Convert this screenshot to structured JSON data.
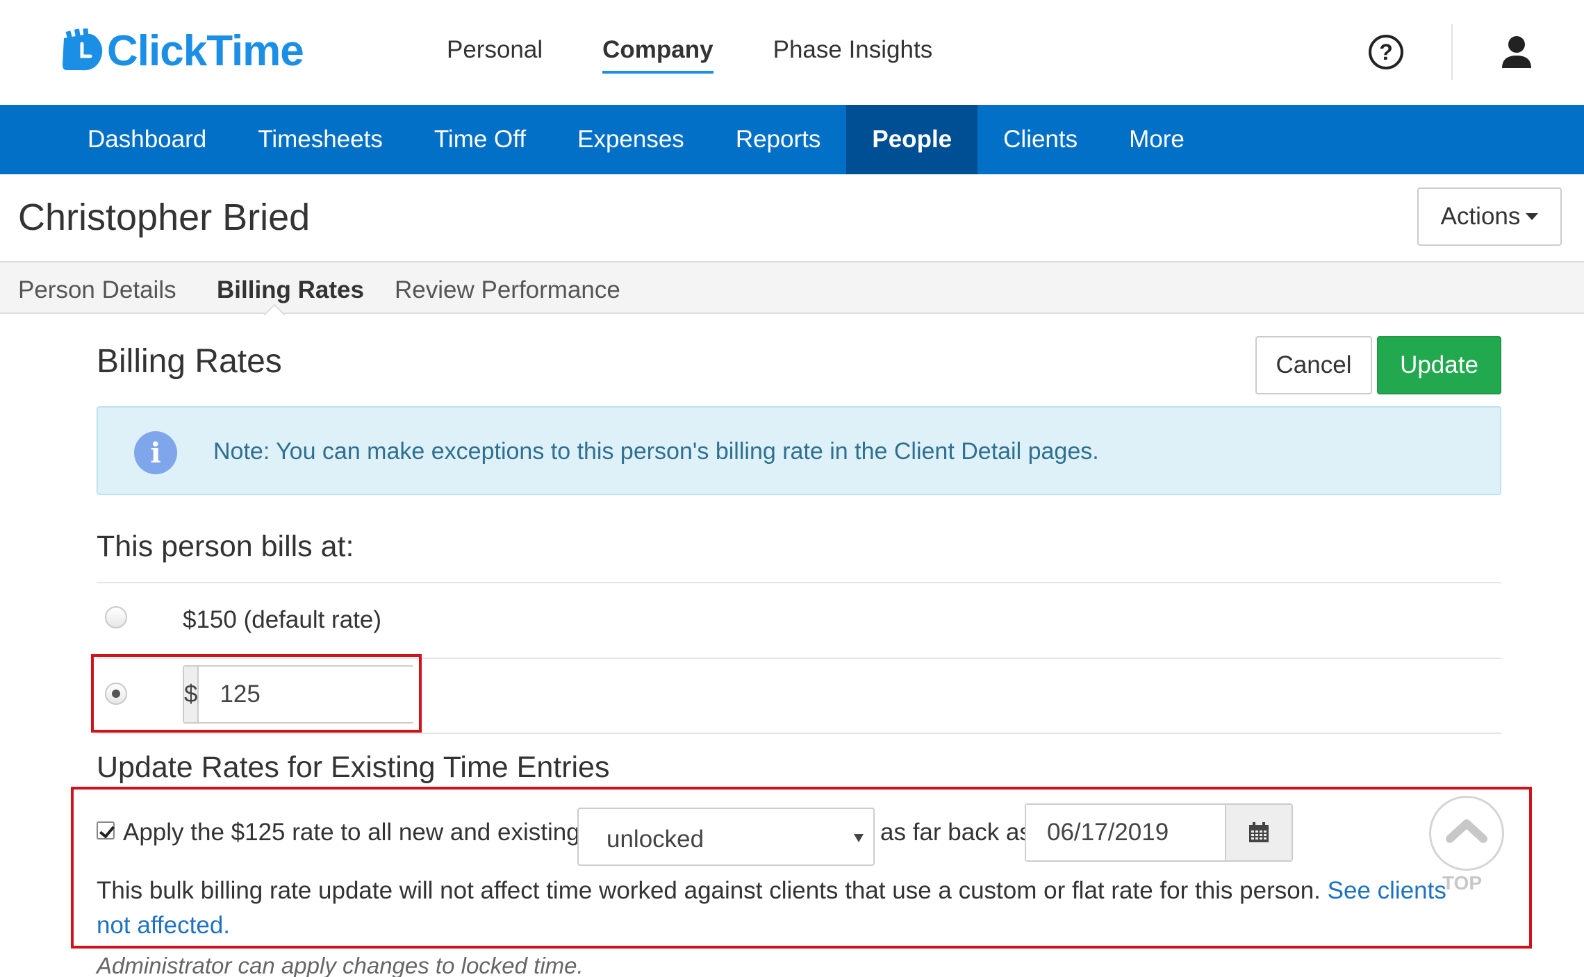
{
  "brand": {
    "name": "ClickTime",
    "color": "#1b8fe6"
  },
  "top_nav": {
    "items": [
      "Personal",
      "Company",
      "Phase Insights"
    ],
    "active": "Company"
  },
  "header_icons": [
    "help-icon",
    "user-icon"
  ],
  "main_nav": {
    "items": [
      "Dashboard",
      "Timesheets",
      "Time Off",
      "Expenses",
      "Reports",
      "People",
      "Clients",
      "More"
    ],
    "active": "People",
    "bg_color": "#0370c8"
  },
  "page": {
    "title": "Christopher Bried",
    "actions_label": "Actions"
  },
  "tabs": {
    "items": [
      "Person Details",
      "Billing Rates",
      "Review Performance"
    ],
    "active": "Billing Rates"
  },
  "billing": {
    "title": "Billing Rates",
    "cancel_label": "Cancel",
    "update_label": "Update",
    "note": "Note: You can make exceptions to this person's billing rate in the Client Detail pages.",
    "bills_at_label": "This person bills at:",
    "default_rate_label": "$150 (default rate)",
    "custom_selected": true,
    "currency_symbol": "$",
    "custom_rate_value": "125"
  },
  "existing": {
    "title": "Update Rates for Existing Time Entries",
    "apply_checked": true,
    "apply_label": "Apply the $125 rate to all new and existing",
    "entry_type_value": "unlocked",
    "far_back_label": "as far back as",
    "date_value": "06/17/2019",
    "bulk_note": "This bulk billing rate update will not affect time worked against clients that use a custom or flat rate for this person.",
    "see_clients_link": "See clients not affected.",
    "admin_note": "Administrator can apply changes to locked time."
  },
  "scroll_top": {
    "label": "TOP"
  },
  "colors": {
    "update_green": "#22a84e",
    "link_blue": "#1f72c2",
    "highlight_red": "#d0121b",
    "note_bg": "#def1f9"
  }
}
